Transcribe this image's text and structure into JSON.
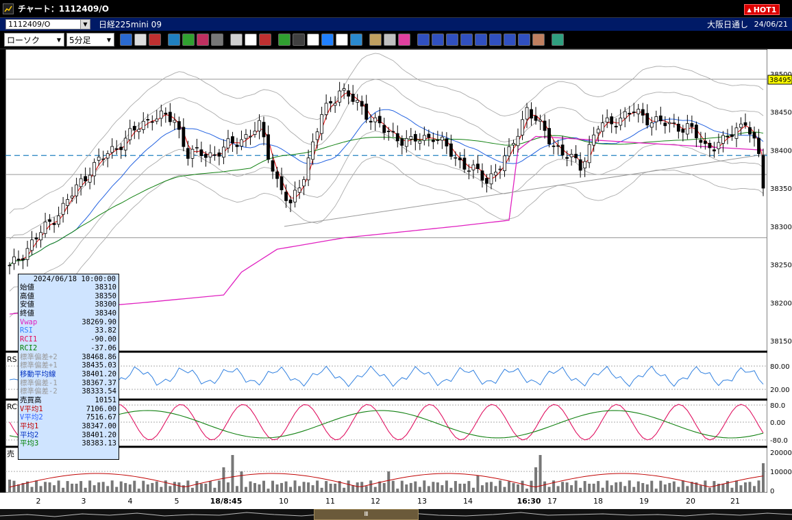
{
  "window": {
    "title": "チャート：1112409/O"
  },
  "hot_button": {
    "label": "HOT1"
  },
  "infobar": {
    "symbol": "1112409/O",
    "name": "日経225mini 09",
    "market": "大阪日通し",
    "date": "24/06/21"
  },
  "toolbar": {
    "chart_type": "ローソク",
    "interval": "5分足",
    "buttons": [
      "zoom",
      "line",
      "alert",
      "info",
      "chart2",
      "trade",
      "disabled",
      "candle",
      "mixed",
      "all",
      "draw",
      "trend",
      "cursor",
      "arrow",
      "memo",
      "trash",
      "settings",
      "tools",
      "color",
      "MA",
      "BB",
      "MAE",
      "HL",
      "ATR",
      "PAR",
      "PVT",
      "box",
      "Log",
      "export"
    ]
  },
  "chart": {
    "period_label": "5分足",
    "price_axis": [
      "38450",
      "38400",
      "38350",
      "38300",
      "38250",
      "38200",
      "38150"
    ],
    "price_top_partial": "38500",
    "last_price_tag": "38495",
    "rsi_label": "RS",
    "rsi_axis": [
      "80.00",
      "20.00"
    ],
    "rci_label": "RC",
    "rci_axis": [
      "80.0",
      "0.00",
      "-80.0"
    ],
    "vol_label": "売",
    "vol_axis": [
      "20000",
      "10000",
      "0"
    ],
    "x_labels": [
      "2",
      "3",
      "4",
      "5",
      "18/8:45",
      "10",
      "11",
      "12",
      "13",
      "14",
      "16:30",
      "17",
      "18",
      "19",
      "20",
      "21"
    ]
  },
  "popup": {
    "datetime": "2024/06/18  10:00:00",
    "rows": [
      {
        "label": "始値",
        "value": "38310",
        "color": "#000"
      },
      {
        "label": "高値",
        "value": "38350",
        "color": "#000"
      },
      {
        "label": "安値",
        "value": "38300",
        "color": "#000"
      },
      {
        "label": "終値",
        "value": "38340",
        "color": "#000"
      },
      {
        "label": "Vwap",
        "value": "38269.90",
        "color": "#e020c0"
      },
      {
        "label": "RSI",
        "value": "33.82",
        "color": "#3080ff"
      },
      {
        "label": "RCI1",
        "value": "-90.00",
        "color": "#e01060"
      },
      {
        "label": "RCI2",
        "value": "-37.06",
        "color": "#008000"
      },
      {
        "label": "標準偏差+2",
        "value": "38468.86",
        "color": "#999"
      },
      {
        "label": "標準偏差+1",
        "value": "38435.03",
        "color": "#999"
      },
      {
        "label": "移動平均線",
        "value": "38401.20",
        "color": "#0030c0"
      },
      {
        "label": "標準偏差-1",
        "value": "38367.37",
        "color": "#999"
      },
      {
        "label": "標準偏差-2",
        "value": "38333.54",
        "color": "#999"
      },
      {
        "label": "売買高",
        "value": "10151",
        "color": "#000"
      },
      {
        "label": "V平均1",
        "value": "7106.00",
        "color": "#c00000"
      },
      {
        "label": "V平均2",
        "value": "7516.67",
        "color": "#3060ff"
      },
      {
        "label": "平均1",
        "value": "38347.00",
        "color": "#c00000"
      },
      {
        "label": "平均2",
        "value": "38401.20",
        "color": "#0030c0"
      },
      {
        "label": "平均3",
        "value": "38383.13",
        "color": "#008000"
      }
    ]
  },
  "scrollbar": {
    "thumb_glyph": "Ⅲ"
  }
}
